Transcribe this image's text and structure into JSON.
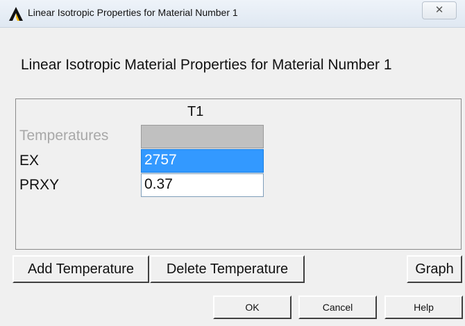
{
  "window": {
    "title": "Linear Isotropic Properties for Material Number 1",
    "close_glyph": "✕"
  },
  "dialog": {
    "heading": "Linear Isotropic Material Properties for Material Number 1",
    "column_header": "T1",
    "rows": [
      {
        "label": "Temperatures",
        "value": "",
        "state": "disabled"
      },
      {
        "label": "EX",
        "value": "2757",
        "state": "selected"
      },
      {
        "label": "PRXY",
        "value": "0.37",
        "state": "normal"
      }
    ]
  },
  "buttons": {
    "add_temperature": "Add Temperature",
    "delete_temperature": "Delete Temperature",
    "graph": "Graph",
    "ok": "OK",
    "cancel": "Cancel",
    "help": "Help"
  },
  "icons": {
    "app": "ansys-logo-icon",
    "close": "close-icon"
  },
  "colors": {
    "selection": "#3399ff",
    "disabled_cell": "#c0c0c0",
    "disabled_text": "#a8a8a8"
  }
}
